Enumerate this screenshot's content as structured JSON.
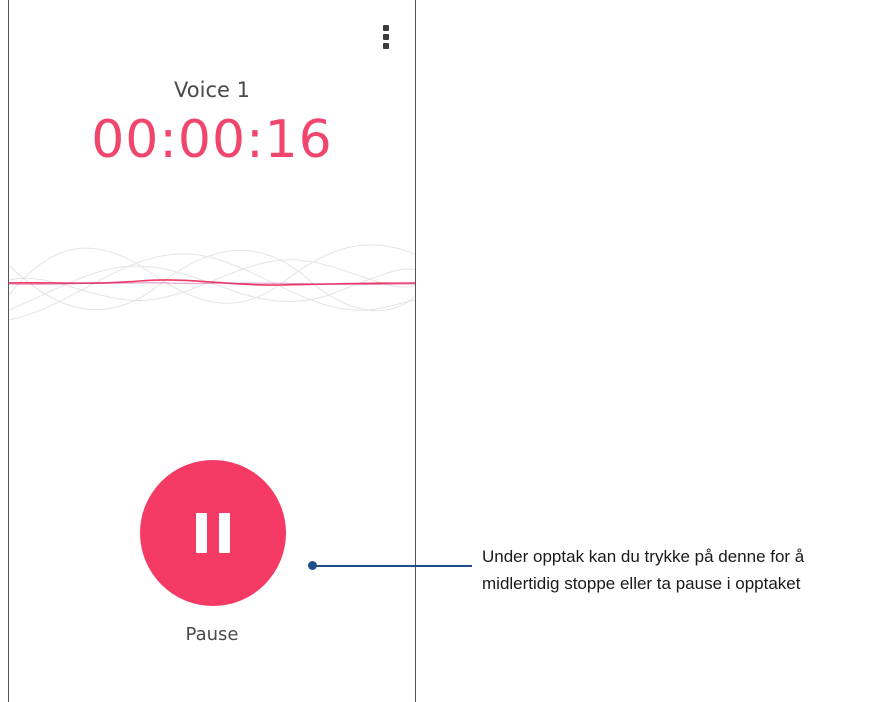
{
  "recorder": {
    "recording_name": "Voice 1",
    "elapsed_time": "00:00:16",
    "pause_label": "Pause",
    "accent_color": "#f53a66",
    "menu_icon": "more-vert-icon",
    "pause_icon": "pause-icon"
  },
  "callout": {
    "line1": "Under opptak kan du trykke på denne for å",
    "line2": "midlertidig stoppe eller ta pause i opptaket",
    "line_color": "#1f4e8a"
  }
}
